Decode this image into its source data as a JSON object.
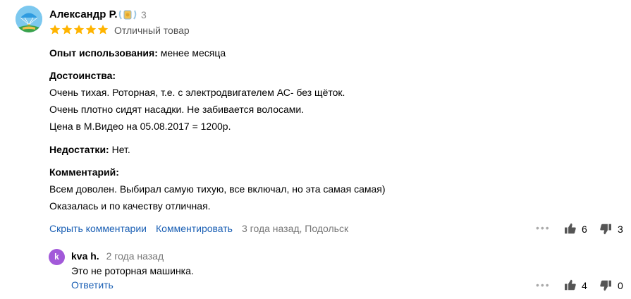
{
  "review": {
    "author": "Александр Р.",
    "badge_count": "3",
    "rating_stars": 5,
    "rating_text": "Отличный товар",
    "usage_label": "Опыт использования:",
    "usage_value": "менее месяца",
    "pros_label": "Достоинства:",
    "pros_lines": [
      "Очень тихая. Роторная, т.е. с электродвигателем АС- без щёток.",
      "Очень плотно сидят насадки. Не забивается волосами.",
      "Цена в М.Видео на 05.08.2017 = 1200р."
    ],
    "cons_label": "Недостатки:",
    "cons_value": "Нет.",
    "comment_label": "Комментарий:",
    "comment_lines": [
      "Всем доволен. Выбирал самую тихую, все включал, но эта самая самая)",
      "Оказалась и по качеству отличная."
    ],
    "hide_comments_link": "Скрыть комментарии",
    "comment_link": "Комментировать",
    "meta": "3 года назад, Подольск",
    "more": "•••",
    "likes": "6",
    "dislikes": "3"
  },
  "reply": {
    "avatar_letter": "k",
    "author": "kva h.",
    "time": "2 года назад",
    "text": "Это не роторная машинка.",
    "reply_link": "Ответить",
    "more": "•••",
    "likes": "4",
    "dislikes": "0"
  },
  "colors": {
    "star": "#ffb400",
    "link": "#1a5fb4",
    "reply_avatar": "#a259d9"
  }
}
